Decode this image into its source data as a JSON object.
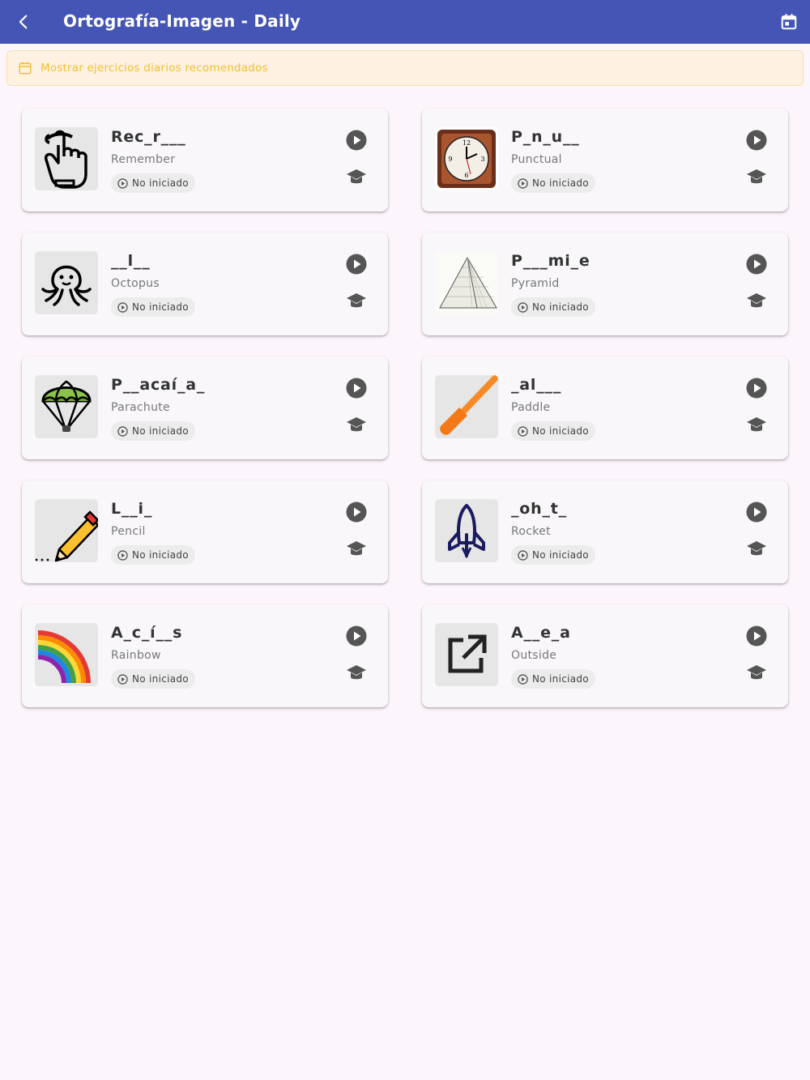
{
  "appbar": {
    "title": "Ortografía-Imagen - Daily",
    "back_icon": "chevron-left-icon",
    "calendar_icon": "calendar-icon",
    "background": "#4555b5"
  },
  "banner": {
    "text": "Mostrar ejercicios diarios recomendados",
    "icon": "calendar-icon",
    "color": "#f2c12e"
  },
  "cards": [
    {
      "word": "Rec_r___",
      "translation": "Remember",
      "status": "No iniciado",
      "image": "finger-string-icon"
    },
    {
      "word": "P_n_u__",
      "translation": "Punctual",
      "status": "No iniciado",
      "image": "wall-clock-image"
    },
    {
      "word": "__l__",
      "translation": "Octopus",
      "status": "No iniciado",
      "image": "octopus-icon"
    },
    {
      "word": "P___mi_e",
      "translation": "Pyramid",
      "status": "No iniciado",
      "image": "pyramid-sketch-image"
    },
    {
      "word": "P__acaí_a_",
      "translation": "Parachute",
      "status": "No iniciado",
      "image": "parachute-icon"
    },
    {
      "word": "_al___",
      "translation": "Paddle",
      "status": "No iniciado",
      "image": "paddle-icon"
    },
    {
      "word": "L__i_",
      "translation": "Pencil",
      "status": "No iniciado",
      "image": "pencil-icon"
    },
    {
      "word": "_oh_t_",
      "translation": "Rocket",
      "status": "No iniciado",
      "image": "rocket-icon"
    },
    {
      "word": "A_c_í__s",
      "translation": "Rainbow",
      "status": "No iniciado",
      "image": "rainbow-icon"
    },
    {
      "word": "A__e_a",
      "translation": "Outside",
      "status": "No iniciado",
      "image": "external-link-icon"
    }
  ],
  "card_actions": {
    "play_icon": "play-circle-icon",
    "learn_icon": "graduation-cap-icon"
  }
}
